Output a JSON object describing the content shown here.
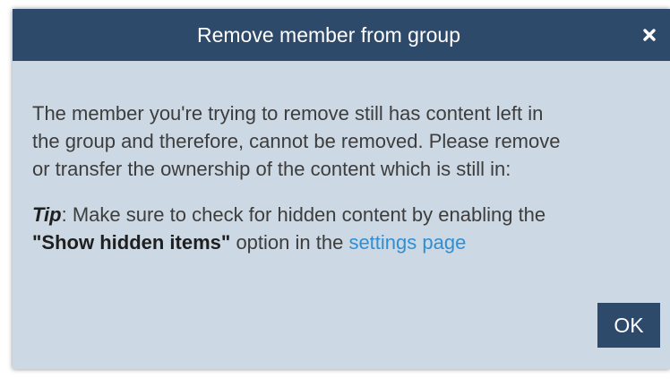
{
  "dialog": {
    "title": "Remove member from group",
    "close_icon": "close-icon",
    "message_lines": [
      "The member you're trying to remove still has content left in",
      "the group and therefore, cannot be removed. Please remove",
      "or transfer the ownership of the content which is still in:"
    ],
    "tip": {
      "label": "Tip",
      "text_1": ": Make sure to check for hidden content by enabling the",
      "option_name": "\"Show hidden items\"",
      "text_2": " option in the ",
      "link_text": "settings page"
    },
    "ok_label": "OK"
  },
  "colors": {
    "titlebar": "#2e4a6b",
    "dialog_bg": "#ccd8e3",
    "link": "#2f8fd6",
    "text": "#3d3d3d"
  }
}
